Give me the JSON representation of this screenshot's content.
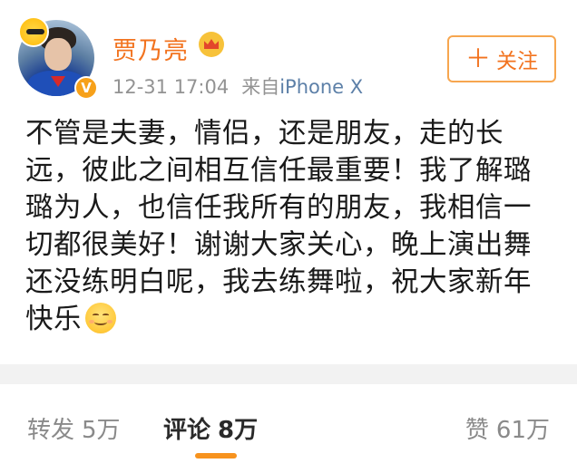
{
  "post": {
    "user": {
      "name": "贾乃亮",
      "verified_badge": "V",
      "avatar_icon": "avatar-image",
      "member_icon": "crown-icon"
    },
    "meta": {
      "time": "12-31 17:04",
      "source_prefix": "来自",
      "source_device": "iPhone X"
    },
    "follow_button": {
      "plus": "＋",
      "label": "关注"
    },
    "content_lines": [
      "不管是夫妻，情侣，还是朋友，走的长",
      "远，彼此之间相互信任最重要！我了解璐",
      "璐为人，也信任我所有的朋友，我相信一",
      "切都很美好！谢谢大家关心，晚上演出舞",
      "还没练明白呢，我去练舞啦，祝大家新年",
      "快乐"
    ],
    "content_emoji": "smile-emoji-icon"
  },
  "tabs": {
    "repost": {
      "label": "转发",
      "count": "5万"
    },
    "comment": {
      "label": "评论",
      "count": "8万"
    },
    "like": {
      "label": "赞",
      "count": "61万"
    }
  },
  "colors": {
    "accent": "#f2731f",
    "link": "#5d80a8",
    "indicator": "#f7931e"
  }
}
